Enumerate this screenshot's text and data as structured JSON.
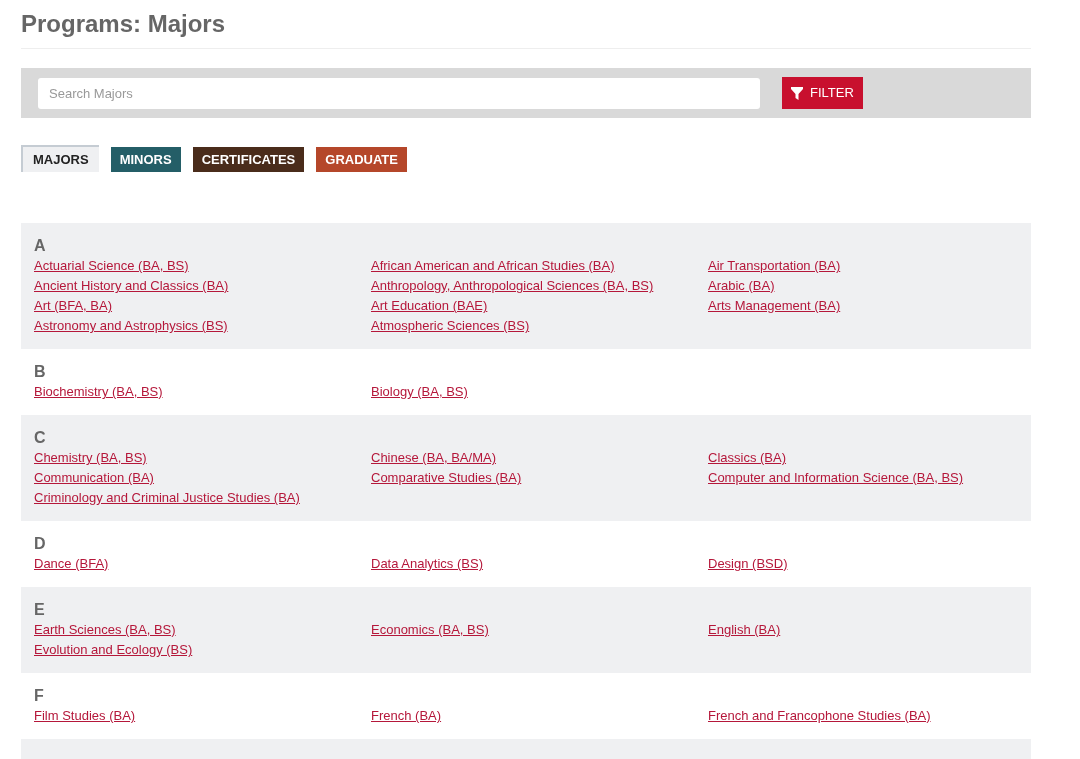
{
  "title": "Programs: Majors",
  "search": {
    "placeholder": "Search Majors"
  },
  "filter_button": "FILTER",
  "tabs": [
    {
      "label": "MAJORS",
      "selected": true
    },
    {
      "label": "MINORS",
      "selected": false,
      "color": "#245e67"
    },
    {
      "label": "CERTIFICATES",
      "selected": false,
      "color": "#4a2c1b"
    },
    {
      "label": "GRADUATE",
      "selected": false,
      "color": "#b5472a"
    }
  ],
  "sections": [
    {
      "letter": "A",
      "links": [
        "Actuarial Science (BA, BS)",
        "African American and African Studies (BA)",
        "Air Transportation (BA)",
        "Ancient History and Classics (BA)",
        "Anthropology, Anthropological Sciences (BA, BS)",
        "Arabic (BA)",
        "Art (BFA, BA)",
        "Art Education (BAE)",
        "Arts Management (BA)",
        "Astronomy and Astrophysics (BS)",
        "Atmospheric Sciences (BS)"
      ]
    },
    {
      "letter": "B",
      "links": [
        "Biochemistry (BA, BS)",
        "Biology (BA, BS)"
      ]
    },
    {
      "letter": "C",
      "links": [
        "Chemistry (BA, BS)",
        "Chinese (BA, BA/MA)",
        "Classics (BA)",
        "Communication (BA)",
        "Comparative Studies (BA)",
        "Computer and Information Science (BA, BS)",
        "Criminology and Criminal Justice Studies (BA)"
      ]
    },
    {
      "letter": "D",
      "links": [
        "Dance (BFA)",
        "Data Analytics (BS)",
        "Design (BSD)"
      ]
    },
    {
      "letter": "E",
      "links": [
        "Earth Sciences (BA, BS)",
        "Economics (BA, BS)",
        "English (BA)",
        "Evolution and Ecology (BS)"
      ]
    },
    {
      "letter": "F",
      "links": [
        "Film Studies (BA)",
        "French (BA)",
        "French and Francophone Studies (BA)"
      ]
    }
  ]
}
